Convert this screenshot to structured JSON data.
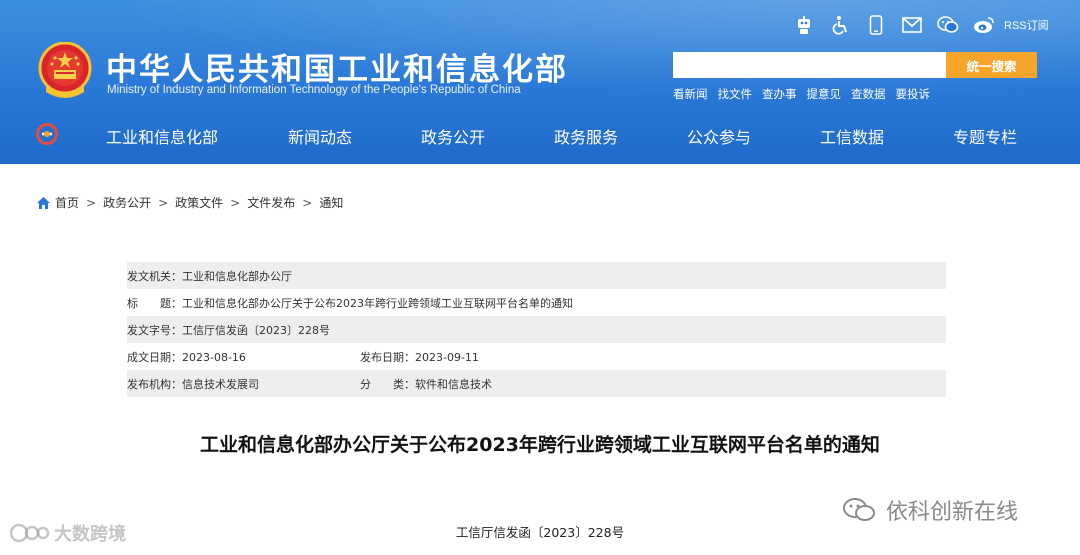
{
  "site": {
    "title": "中华人民共和国工业和信息化部",
    "subtitle": "Ministry of Industry and Information Technology of the People's Republic of China"
  },
  "top_icons": [
    {
      "icon": "robot-icon"
    },
    {
      "icon": "accessibility-icon"
    },
    {
      "icon": "mobile-icon"
    },
    {
      "icon": "mail-icon"
    },
    {
      "icon": "wechat-icon"
    },
    {
      "icon": "weibo-icon"
    }
  ],
  "rss_label": "RSS订阅",
  "search": {
    "placeholder": "",
    "button_label": "统一搜索"
  },
  "quick_links": [
    "看新闻",
    "找文件",
    "查办事",
    "提意见",
    "查数据",
    "要投诉"
  ],
  "nav": [
    "工业和信息化部",
    "新闻动态",
    "政务公开",
    "政务服务",
    "公众参与",
    "工信数据",
    "专题专栏"
  ],
  "breadcrumb": [
    "首页",
    "政务公开",
    "政策文件",
    "文件发布",
    "通知"
  ],
  "info": {
    "issuer": "发文机关：工业和信息化部办公厅",
    "title": "标　　题：工业和信息化部办公厅关于公布2023年跨行业跨领域工业互联网平台名单的通知",
    "doc_no": "发文字号：工信厅信发函〔2023〕228号",
    "created": "成文日期：2023-08-16",
    "published": "发布日期：2023-09-11",
    "org": "发布机构：信息技术发展司",
    "category": "分　　类：软件和信息技术"
  },
  "doc_title": "工业和信息化部办公厅关于公布2023年跨行业跨领域工业互联网平台名单的通知",
  "doc_number": "工信厅信发函〔2023〕228号",
  "watermarks": {
    "left": "大数跨境",
    "right": "依科创新在线"
  },
  "colors": {
    "header_blue": "#2a78d6",
    "search_orange": "#f4a52a"
  }
}
